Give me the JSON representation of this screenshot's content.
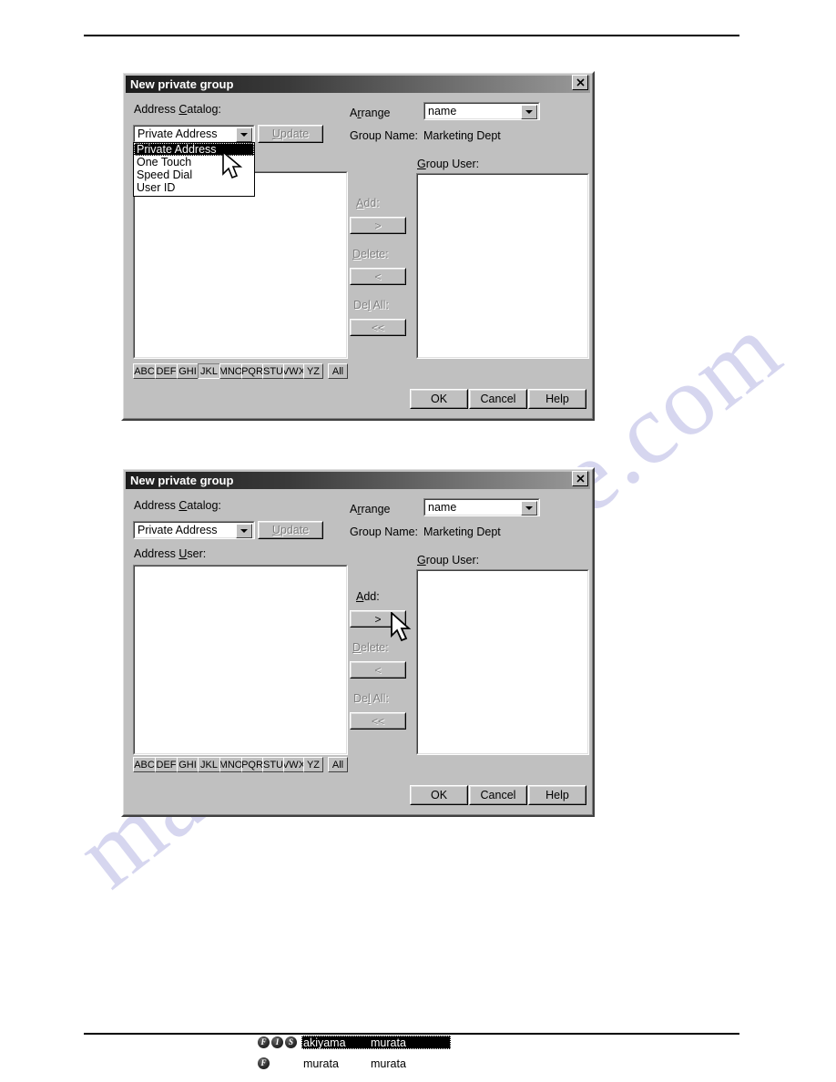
{
  "page": {
    "watermark_text": "manualsarchive.com"
  },
  "dialogs": [
    {
      "id": "dialog-top",
      "title": "New private group",
      "close_label": "✕",
      "labels": {
        "address_catalog": "Address Catalog:",
        "address_catalog_accel": "C",
        "arrange": "Arrange",
        "arrange_accel": "r",
        "group_name_label": "Group Name:",
        "group_name_value": "Marketing Dept",
        "group_user": "Group User:",
        "group_user_accel": "G",
        "address_user": ""
      },
      "catalog_combo": {
        "value": "Private Address",
        "open": true,
        "options": [
          {
            "label": "Private Address",
            "selected": true
          },
          {
            "label": "One Touch",
            "selected": false
          },
          {
            "label": "Speed Dial",
            "selected": false
          },
          {
            "label": "User ID",
            "selected": false
          }
        ]
      },
      "arrange_combo": {
        "value": "name"
      },
      "update_button": {
        "label": "Update",
        "accel": "U",
        "enabled": false
      },
      "transfer": [
        {
          "caption": "Add:",
          "accel": "A",
          "glyph": ">",
          "enabled": false
        },
        {
          "caption": "Delete:",
          "accel": "D",
          "glyph": "<",
          "enabled": false
        },
        {
          "caption": "Del All:",
          "accel": "l",
          "glyph": "<<",
          "enabled": false
        }
      ],
      "letter_buttons": [
        {
          "label": "ABC",
          "active": false
        },
        {
          "label": "DEF",
          "active": false
        },
        {
          "label": "GHI",
          "active": false
        },
        {
          "label": "JKL",
          "active": true
        },
        {
          "label": "MNO",
          "active": false
        },
        {
          "label": "PQR",
          "active": false
        },
        {
          "label": "STU",
          "active": false
        },
        {
          "label": "VWX",
          "active": false
        },
        {
          "label": "YZ",
          "active": false
        },
        {
          "label": "All",
          "active": false
        }
      ],
      "address_rows": [],
      "group_rows": [],
      "footer_buttons": [
        {
          "label": "OK"
        },
        {
          "label": "Cancel"
        },
        {
          "label": "Help"
        }
      ]
    },
    {
      "id": "dialog-bottom",
      "title": "New private group",
      "close_label": "✕",
      "labels": {
        "address_catalog": "Address Catalog:",
        "address_catalog_accel": "C",
        "arrange": "Arrange",
        "arrange_accel": "r",
        "group_name_label": "Group Name:",
        "group_name_value": "Marketing Dept",
        "group_user": "Group User:",
        "group_user_accel": "G",
        "address_user": "Address User:",
        "address_user_accel": "U"
      },
      "catalog_combo": {
        "value": "Private Address",
        "open": false,
        "options": [
          {
            "label": "Private Address",
            "selected": true
          },
          {
            "label": "One Touch",
            "selected": false
          },
          {
            "label": "Speed Dial",
            "selected": false
          },
          {
            "label": "User ID",
            "selected": false
          }
        ]
      },
      "arrange_combo": {
        "value": "name"
      },
      "update_button": {
        "label": "Update",
        "accel": "U",
        "enabled": false
      },
      "transfer": [
        {
          "caption": "Add:",
          "accel": "A",
          "glyph": ">",
          "enabled": true
        },
        {
          "caption": "Delete:",
          "accel": "D",
          "glyph": "<",
          "enabled": false
        },
        {
          "caption": "Del All:",
          "accel": "l",
          "glyph": "<<",
          "enabled": false
        }
      ],
      "letter_buttons": [
        {
          "label": "ABC",
          "active": false
        },
        {
          "label": "DEF",
          "active": false
        },
        {
          "label": "GHI",
          "active": false
        },
        {
          "label": "JKL",
          "active": false
        },
        {
          "label": "MNO",
          "active": false
        },
        {
          "label": "PQR",
          "active": false
        },
        {
          "label": "STU",
          "active": false
        },
        {
          "label": "VWX",
          "active": false
        },
        {
          "label": "YZ",
          "active": false
        },
        {
          "label": "All",
          "active": false
        }
      ],
      "address_rows": [
        {
          "badges": [
            "F",
            "I",
            "S"
          ],
          "name": "akiyama",
          "second": "murata",
          "selected": true
        },
        {
          "badges": [
            "F"
          ],
          "name": "murata",
          "second": "murata",
          "selected": false
        }
      ],
      "group_rows": [],
      "footer_buttons": [
        {
          "label": "OK"
        },
        {
          "label": "Cancel"
        },
        {
          "label": "Help"
        }
      ]
    }
  ]
}
